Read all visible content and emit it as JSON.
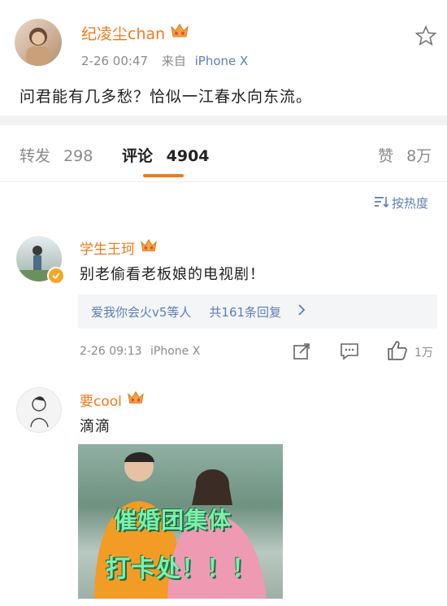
{
  "post": {
    "author": "纪凌尘chan",
    "time": "2-26 00:47",
    "source_prefix": "来自",
    "source": "iPhone X",
    "content": "问君能有几多愁？恰似一江春水向东流。"
  },
  "tabs": {
    "repost_label": "转发",
    "repost_count": "298",
    "comment_label": "评论",
    "comment_count": "4904",
    "like_label": "赞",
    "like_count": "8万"
  },
  "sort": {
    "label": "按热度"
  },
  "comments": [
    {
      "author": "学生王珂",
      "text": "别老偷看老板娘的电视剧！",
      "replies_users": "爱我你会火v5等人",
      "replies_count": "共161条回复",
      "time": "2-26 09:13",
      "source": "iPhone X",
      "likes": "1万"
    },
    {
      "author": "要cool",
      "text": "滴滴",
      "image_text_line1": "催婚团集体",
      "image_text_line2": "打卡处！！！"
    }
  ],
  "colors": {
    "accent": "#f07b1b",
    "link": "#5b7fb5",
    "gray": "#8a8a8a"
  }
}
